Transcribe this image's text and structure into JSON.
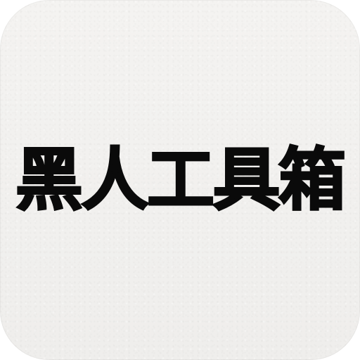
{
  "app_icon": {
    "name": "黑人工具箱",
    "background_color": "#f1f0ee",
    "text_color": "#0a0a0a"
  }
}
